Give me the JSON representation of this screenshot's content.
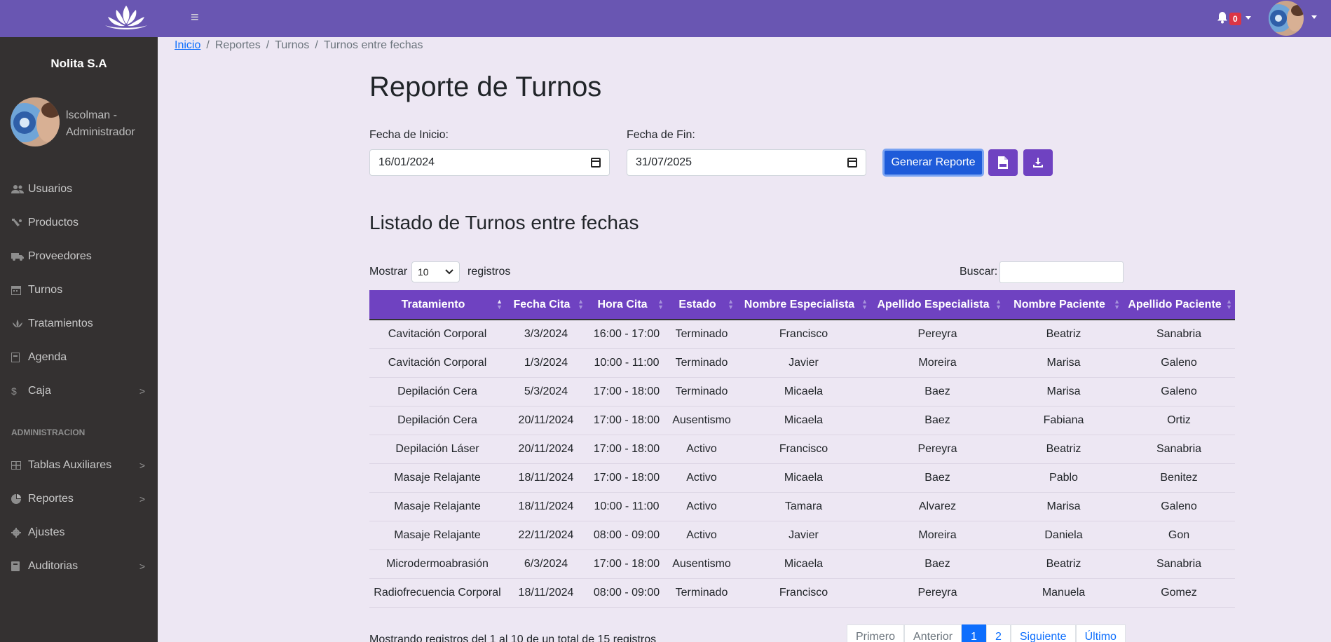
{
  "topbar": {
    "logo": "lotus-logo",
    "menu_icon": "≡",
    "notifications_count": "0",
    "colors": {
      "background": "#6956b2",
      "badge": "#dc3545"
    }
  },
  "sidebar": {
    "brand": "Nolita S.A",
    "user_line1": "lscolman -",
    "user_line2": "Administrador",
    "items": [
      {
        "label": "Usuarios",
        "icon": "users-icon"
      },
      {
        "label": "Productos",
        "icon": "bottle-icon"
      },
      {
        "label": "Proveedores",
        "icon": "truck-icon"
      },
      {
        "label": "Turnos",
        "icon": "calendar-icon"
      },
      {
        "label": "Tratamientos",
        "icon": "lotus-icon"
      },
      {
        "label": "Agenda",
        "icon": "book-icon"
      },
      {
        "label": "Caja",
        "icon": "dollar-icon"
      }
    ],
    "section_label": "ADMINISTRACION",
    "admin_items": [
      {
        "label": "Tablas Auxiliares",
        "icon": "table-icon"
      },
      {
        "label": "Reportes",
        "icon": "pie-chart-icon"
      },
      {
        "label": "Ajustes",
        "icon": "gear-icon"
      },
      {
        "label": "Auditorias",
        "icon": "book-icon"
      }
    ],
    "colors": {
      "background": "#343131"
    }
  },
  "breadcrumb": {
    "items": [
      "Inicio",
      "Reportes",
      "Turnos",
      "Turnos entre fechas"
    ]
  },
  "main": {
    "title": "Reporte de Turnos",
    "start_label": "Fecha de Inicio:",
    "start_value": "16/01/2024",
    "end_label": "Fecha de Fin:",
    "end_value": "31/07/2025",
    "generate_button": "Generar Reporte",
    "pdf_icon": "file-pdf-icon",
    "download_icon": "download-icon",
    "list_title": "Listado de Turnos entre fechas",
    "show_label": "Mostrar",
    "show_value": "10",
    "records_label": "registros",
    "search_label": "Buscar:",
    "search_value": ""
  },
  "table": {
    "headers": [
      "Tratamiento",
      "Fecha Cita",
      "Hora Cita",
      "Estado",
      "Nombre Especialista",
      "Apellido Especialista",
      "Nombre Paciente",
      "Apellido Paciente"
    ],
    "rows": [
      [
        "Cavitación Corporal",
        "3/3/2024",
        "16:00 - 17:00",
        "Terminado",
        "Francisco",
        "Pereyra",
        "Beatriz",
        "Sanabria"
      ],
      [
        "Cavitación Corporal",
        "1/3/2024",
        "10:00 - 11:00",
        "Terminado",
        "Javier",
        "Moreira",
        "Marisa",
        "Galeno"
      ],
      [
        "Depilación Cera",
        "5/3/2024",
        "17:00 - 18:00",
        "Terminado",
        "Micaela",
        "Baez",
        "Marisa",
        "Galeno"
      ],
      [
        "Depilación Cera",
        "20/11/2024",
        "17:00 - 18:00",
        "Ausentismo",
        "Micaela",
        "Baez",
        "Fabiana",
        "Ortiz"
      ],
      [
        "Depilación Láser",
        "20/11/2024",
        "17:00 - 18:00",
        "Activo",
        "Francisco",
        "Pereyra",
        "Beatriz",
        "Sanabria"
      ],
      [
        "Masaje Relajante",
        "18/11/2024",
        "17:00 - 18:00",
        "Activo",
        "Micaela",
        "Baez",
        "Pablo",
        "Benitez"
      ],
      [
        "Masaje Relajante",
        "18/11/2024",
        "10:00 - 11:00",
        "Activo",
        "Tamara",
        "Alvarez",
        "Marisa",
        "Galeno"
      ],
      [
        "Masaje Relajante",
        "22/11/2024",
        "08:00 - 09:00",
        "Activo",
        "Javier",
        "Moreira",
        "Daniela",
        "Gon"
      ],
      [
        "Microdermoabrasión",
        "6/3/2024",
        "17:00 - 18:00",
        "Ausentismo",
        "Micaela",
        "Baez",
        "Beatriz",
        "Sanabria"
      ],
      [
        "Radiofrecuencia Corporal",
        "18/11/2024",
        "08:00 - 09:00",
        "Terminado",
        "Francisco",
        "Pereyra",
        "Manuela",
        "Gomez"
      ]
    ],
    "colors": {
      "header": "#6f42c1"
    }
  },
  "footer": {
    "info": "Mostrando registros del 1 al 10 de un total de 15 registros",
    "pages": [
      "Primero",
      "Anterior",
      "1",
      "2",
      "Siguiente",
      "Último"
    ]
  }
}
